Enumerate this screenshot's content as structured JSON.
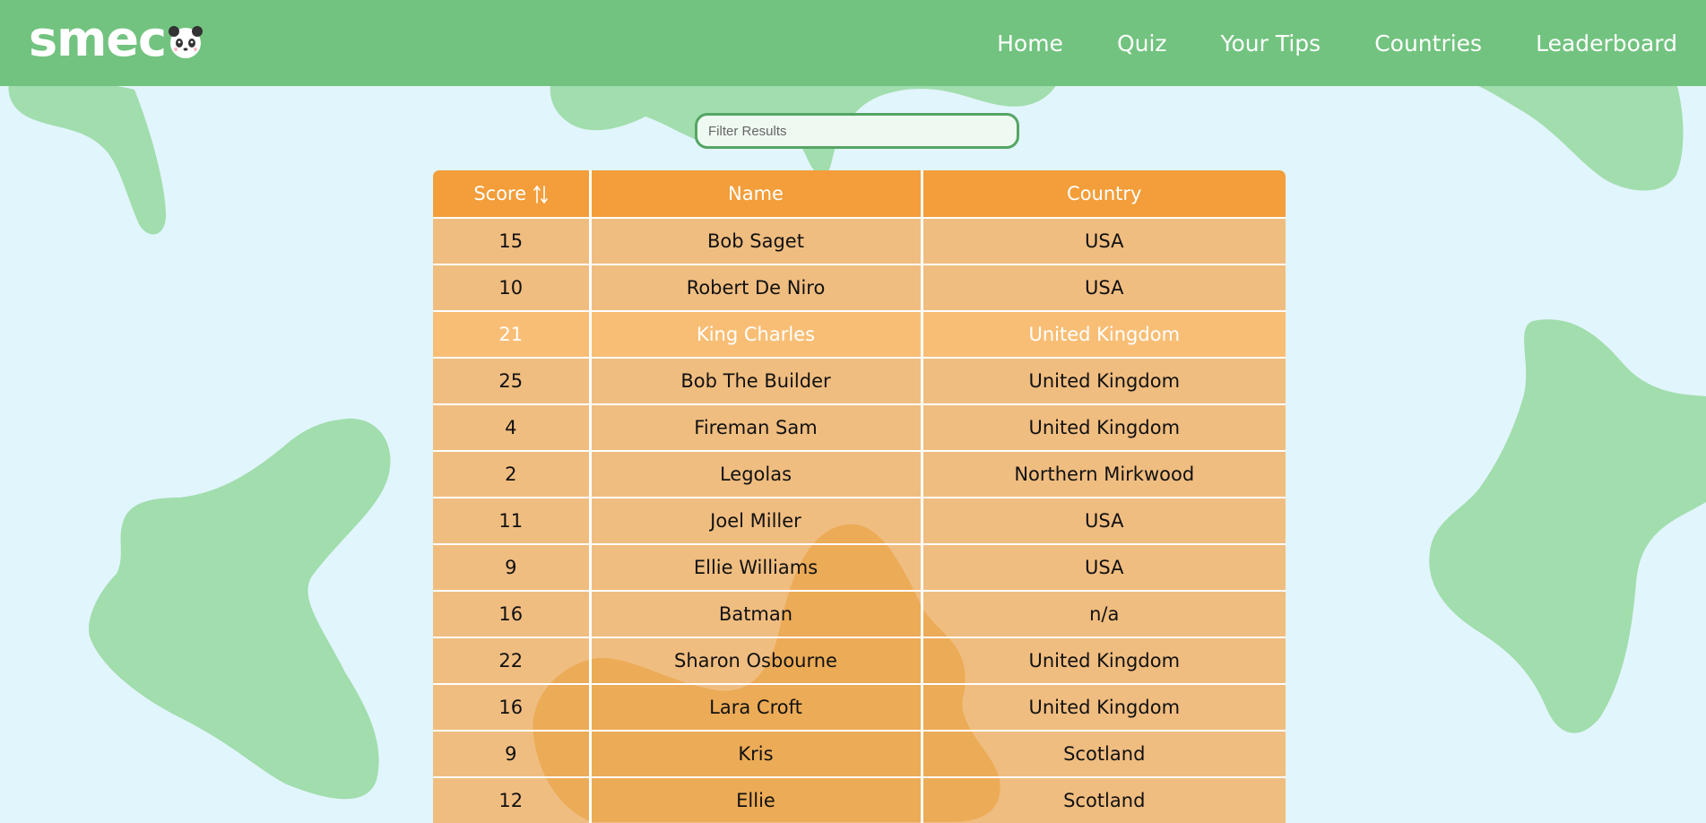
{
  "header": {
    "logo_text": "smec",
    "nav": [
      "Home",
      "Quiz",
      "Your Tips",
      "Countries",
      "Leaderboard"
    ]
  },
  "filter": {
    "placeholder": "Filter Results"
  },
  "table": {
    "columns": [
      "Score",
      "Name",
      "Country"
    ],
    "rows": [
      {
        "score": "15",
        "name": "Bob Saget",
        "country": "USA"
      },
      {
        "score": "10",
        "name": "Robert De Niro",
        "country": "USA"
      },
      {
        "score": "21",
        "name": "King Charles",
        "country": "United Kingdom"
      },
      {
        "score": "25",
        "name": "Bob The Builder",
        "country": "United Kingdom"
      },
      {
        "score": "4",
        "name": "Fireman Sam",
        "country": "United Kingdom"
      },
      {
        "score": "2",
        "name": "Legolas",
        "country": "Northern Mirkwood"
      },
      {
        "score": "11",
        "name": "Joel Miller",
        "country": "USA"
      },
      {
        "score": "9",
        "name": "Ellie Williams",
        "country": "USA"
      },
      {
        "score": "16",
        "name": "Batman",
        "country": "n/a"
      },
      {
        "score": "22",
        "name": "Sharon Osbourne",
        "country": "United Kingdom"
      },
      {
        "score": "16",
        "name": "Lara Croft",
        "country": "United Kingdom"
      },
      {
        "score": "9",
        "name": "Kris",
        "country": "Scotland"
      },
      {
        "score": "12",
        "name": "Ellie",
        "country": "Scotland"
      }
    ]
  },
  "colors": {
    "header_bg": "#72c37f",
    "page_bg": "#e1f5fc",
    "table_header": "#f39e3a",
    "table_row": "#f5a850",
    "blob": "#a1ddad"
  }
}
